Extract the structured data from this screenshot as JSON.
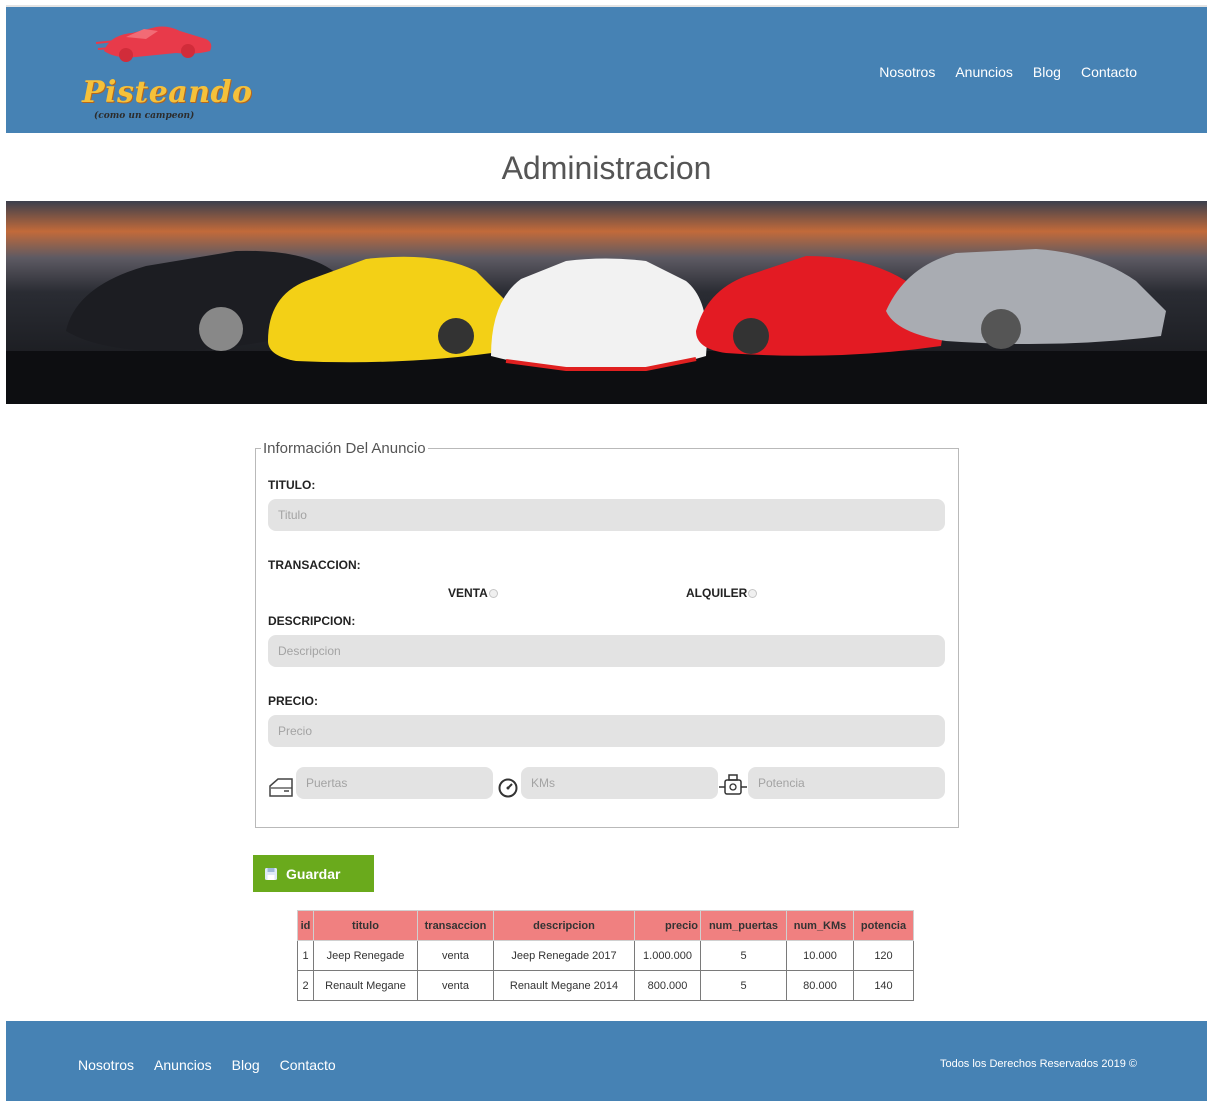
{
  "brand": {
    "name": "Pisteando",
    "tagline": "(como un campeon)"
  },
  "nav": {
    "items": [
      "Nosotros",
      "Anuncios",
      "Blog",
      "Contacto"
    ]
  },
  "page": {
    "title": "Administracion"
  },
  "form": {
    "legend": "Información Del Anuncio",
    "titulo": {
      "label": "TITULO:",
      "placeholder": "Titulo"
    },
    "transaccion": {
      "label": "TRANSACCION:",
      "options": [
        "VENTA",
        "ALQUILER"
      ]
    },
    "descripcion": {
      "label": "DESCRIPCION:",
      "placeholder": "Descripcion"
    },
    "precio": {
      "label": "PRECIO:",
      "placeholder": "Precio"
    },
    "puertas": {
      "placeholder": "Puertas"
    },
    "kms": {
      "placeholder": "KMs"
    },
    "potencia": {
      "placeholder": "Potencia"
    },
    "save_label": "Guardar"
  },
  "table": {
    "headers": [
      "id",
      "titulo",
      "transaccion",
      "descripcion",
      "precio",
      "num_puertas",
      "num_KMs",
      "potencia"
    ],
    "rows": [
      [
        "1",
        "Jeep Renegade",
        "venta",
        "Jeep Renegade 2017",
        "1.000.000",
        "5",
        "10.000",
        "120"
      ],
      [
        "2",
        "Renault Megane",
        "venta",
        "Renault Megane 2014",
        "800.000",
        "5",
        "80.000",
        "140"
      ]
    ]
  },
  "footer": {
    "nav": [
      "Nosotros",
      "Anuncios",
      "Blog",
      "Contacto"
    ],
    "copyright": "Todos los Derechos Reservados 2019 ©"
  },
  "colors": {
    "header_bg": "#4682b4",
    "save_button": "#6aaa1c",
    "table_header": "#f08080",
    "input_bg": "#e3e3e3"
  }
}
